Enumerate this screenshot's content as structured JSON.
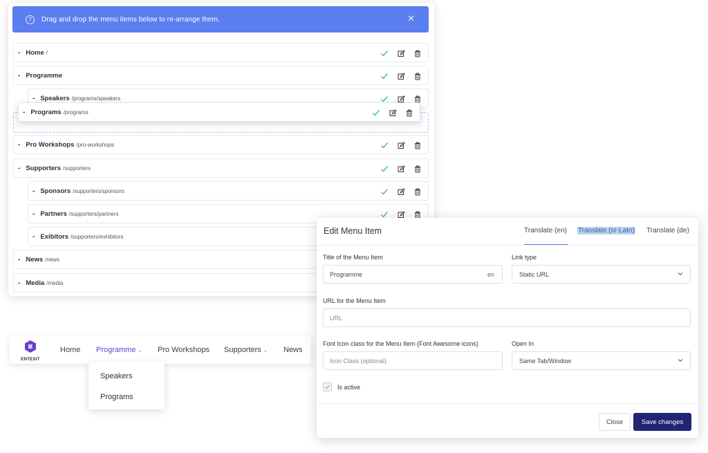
{
  "alert": {
    "text": "Drag and drop the menu items below to re-arrange them.",
    "help_glyph": "?",
    "close_glyph": "✕"
  },
  "menu_items": [
    {
      "title": "Home",
      "path": "/"
    },
    {
      "title": "Programme",
      "path": ""
    },
    {
      "title": "Speakers",
      "path": "/programs/speakers"
    },
    {
      "title": "Programs",
      "path": "/programs"
    },
    {
      "title": "Pro Workshops",
      "path": "/pro-workshops"
    },
    {
      "title": "Supporters",
      "path": "/supporters"
    },
    {
      "title": "Sponsors",
      "path": "/supporters/sponsors"
    },
    {
      "title": "Partners",
      "path": "/supporters/partners"
    },
    {
      "title": "Exibitors",
      "path": "/supporters/exhibitors"
    },
    {
      "title": "News",
      "path": "/news"
    },
    {
      "title": "Media",
      "path": "/media"
    }
  ],
  "row_dash": "-",
  "colors": {
    "accent": "#5b7ef0",
    "check": "#3dbd8c",
    "primary_button": "#1f2572",
    "nav_active": "#6a3fd4"
  },
  "icons": {
    "row_actions": [
      "check-icon",
      "edit-icon",
      "trash-icon"
    ]
  },
  "navbar": {
    "logo_text": "ENTESIT",
    "items": [
      "Home",
      "Programme",
      "Pro Workshops",
      "Supporters",
      "News"
    ],
    "chevron": "⌄",
    "dropdown": [
      "Speakers",
      "Programs"
    ]
  },
  "modal": {
    "title": "Edit Menu Item",
    "tabs": [
      "Translate (en)",
      "Translate (sr-Latn)",
      "Translate (de)"
    ],
    "title_label": "Title of the Menu Item",
    "title_value": "Programme",
    "title_lang": "en",
    "link_type_label": "Link type",
    "link_type_value": "Static URL",
    "url_label": "URL for the Menu Item",
    "url_placeholder": "URL",
    "icon_label": "Font Icon class for the Menu Item (Font Awesome icons)",
    "icon_placeholder": "Icon Class (optional)",
    "open_in_label": "Open In",
    "open_in_value": "Same Tab/Window",
    "active_label": "Is active",
    "close_button": "Close",
    "save_button": "Save changes"
  }
}
